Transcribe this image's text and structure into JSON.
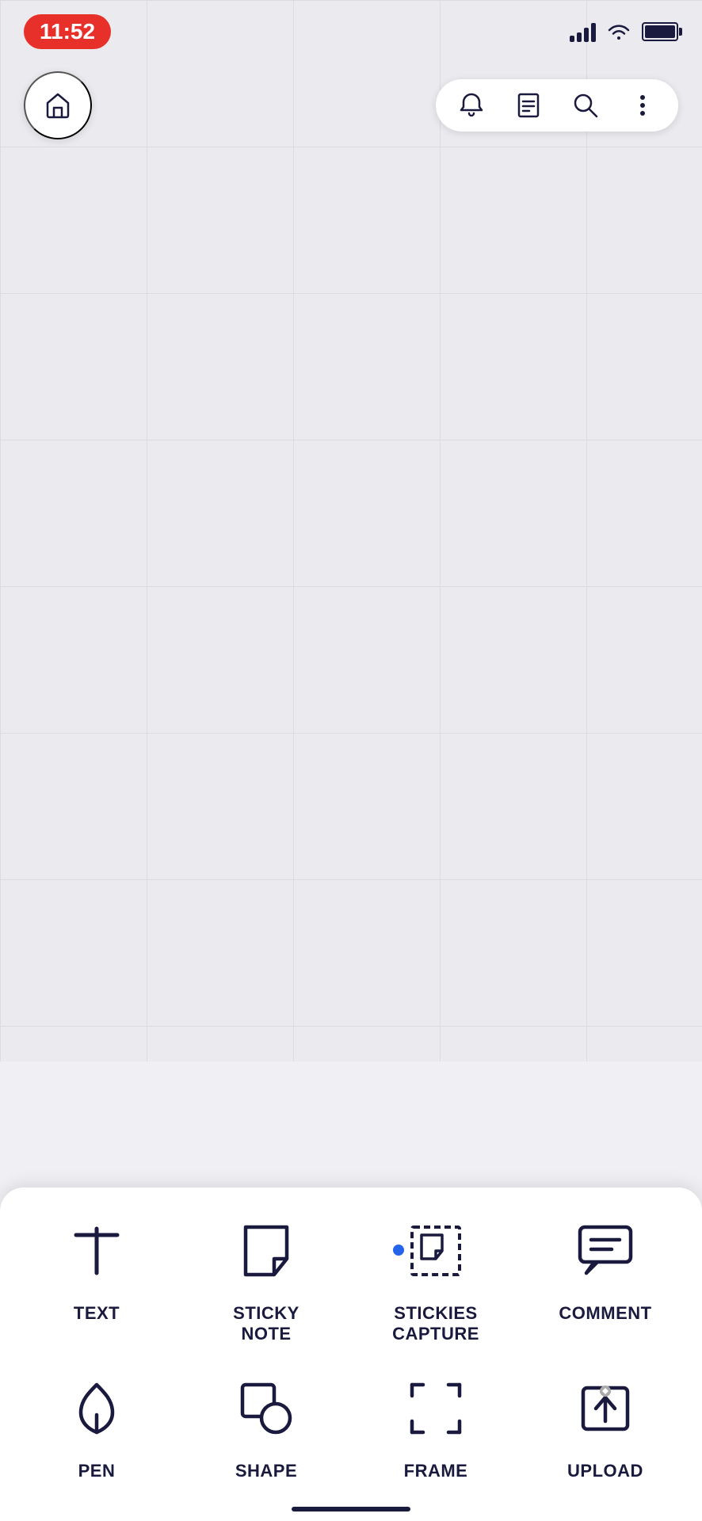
{
  "status_bar": {
    "time": "11:52"
  },
  "nav": {
    "home_label": "home",
    "bell_label": "notifications",
    "notes_label": "notes",
    "search_label": "search",
    "more_label": "more options"
  },
  "tools": [
    {
      "id": "text",
      "label": "TEXT",
      "icon": "text-icon",
      "dot": false
    },
    {
      "id": "sticky-note",
      "label": "STICKY\nNOTE",
      "label_line1": "STICKY",
      "label_line2": "NOTE",
      "icon": "sticky-note-icon",
      "dot": false
    },
    {
      "id": "stickies-capture",
      "label": "STICKIES\nCAPTURE",
      "label_line1": "STICKIES",
      "label_line2": "CAPTURE",
      "icon": "stickies-capture-icon",
      "dot": true
    },
    {
      "id": "comment",
      "label": "COMMENT",
      "icon": "comment-icon",
      "dot": false
    },
    {
      "id": "pen",
      "label": "PEN",
      "icon": "pen-icon",
      "dot": false
    },
    {
      "id": "shape",
      "label": "SHAPE",
      "icon": "shape-icon",
      "dot": false
    },
    {
      "id": "frame",
      "label": "FRAME",
      "icon": "frame-icon",
      "dot": false
    },
    {
      "id": "upload",
      "label": "UPLOAD",
      "icon": "upload-icon",
      "dot": false
    }
  ]
}
